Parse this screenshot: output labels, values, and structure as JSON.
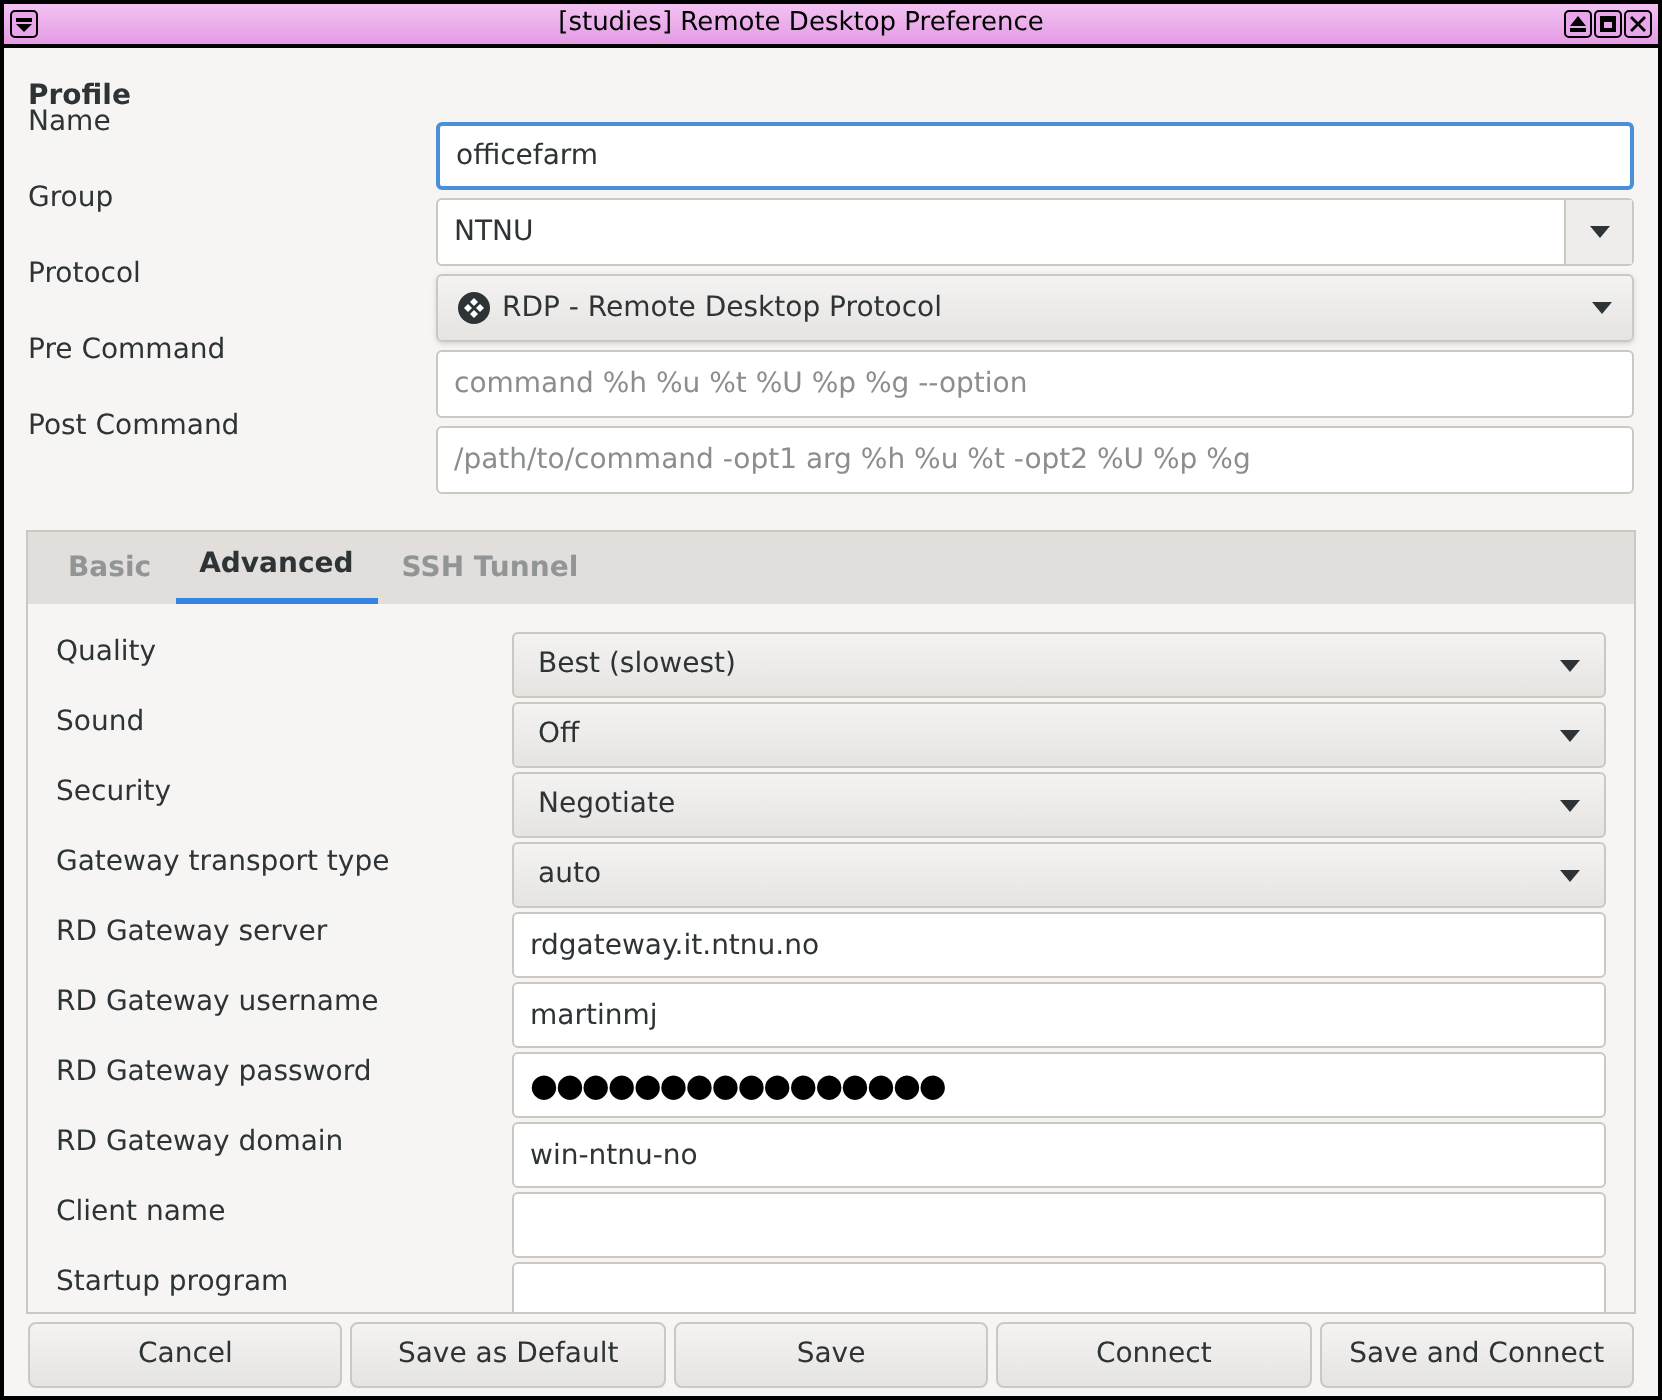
{
  "window": {
    "title": "[studies] Remote Desktop Preference"
  },
  "profile": {
    "heading": "Profile",
    "fields": [
      {
        "kind": "entry",
        "label": "Name",
        "value": "officefarm",
        "focused": true
      },
      {
        "kind": "combo",
        "label": "Group",
        "value": "NTNU",
        "focused": false
      },
      {
        "kind": "select",
        "label": "Protocol",
        "value": "RDP - Remote Desktop Protocol",
        "focused": false
      },
      {
        "kind": "entry",
        "label": "Pre Command",
        "placeholder": "command %h %u %t %U %p %g --option",
        "focused": false
      },
      {
        "kind": "entry",
        "label": "Post Command",
        "placeholder": "/path/to/command -opt1 arg %h %u %t -opt2 %U %p %g",
        "focused": false
      }
    ]
  },
  "tabs": [
    {
      "label": "Basic",
      "selected": false
    },
    {
      "label": "Advanced",
      "selected": true
    },
    {
      "label": "SSH Tunnel",
      "selected": false
    }
  ],
  "advanced": [
    {
      "kind": "select",
      "label": "Quality",
      "value": "Best (slowest)"
    },
    {
      "kind": "select",
      "label": "Sound",
      "value": "Off"
    },
    {
      "kind": "select",
      "label": "Security",
      "value": "Negotiate"
    },
    {
      "kind": "select",
      "label": "Gateway transport type",
      "value": "auto"
    },
    {
      "kind": "entry",
      "label": "RD Gateway server",
      "value": "rdgateway.it.ntnu.no"
    },
    {
      "kind": "entry",
      "label": "RD Gateway username",
      "value": "martinmj"
    },
    {
      "kind": "password",
      "label": "RD Gateway password",
      "value": "●●●●●●●●●●●●●●●●"
    },
    {
      "kind": "entry",
      "label": "RD Gateway domain",
      "value": "win-ntnu-no"
    },
    {
      "kind": "entry",
      "label": "Client name"
    },
    {
      "kind": "entry",
      "label": "Startup program"
    }
  ],
  "buttons": [
    "Cancel",
    "Save as Default",
    "Save",
    "Connect",
    "Save and Connect"
  ]
}
